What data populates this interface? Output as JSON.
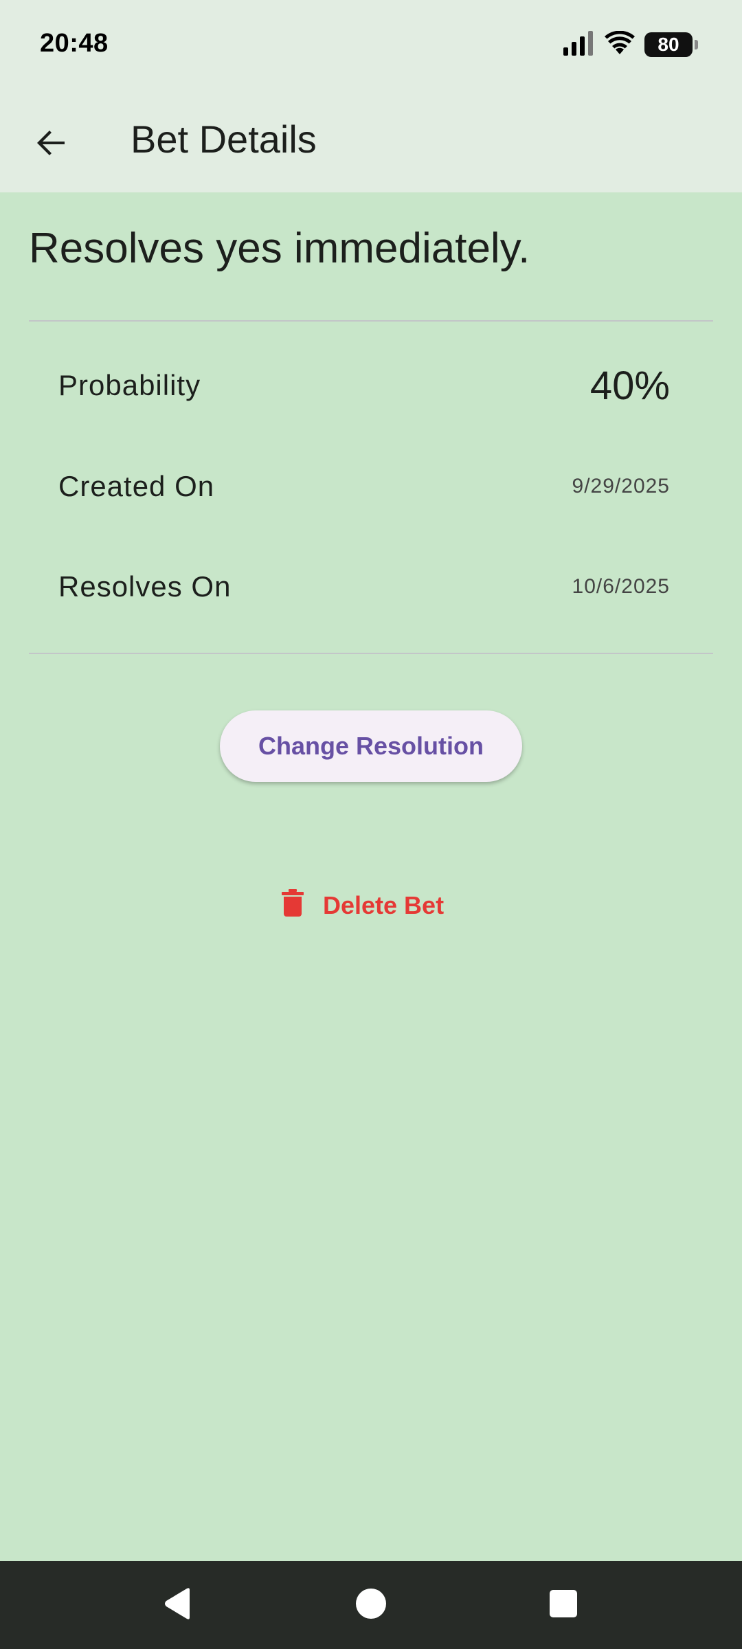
{
  "status_bar": {
    "time": "20:48",
    "battery": "80",
    "icons": [
      "signal-icon",
      "wifi-icon",
      "battery-icon"
    ]
  },
  "app_bar": {
    "title": "Bet Details",
    "back_icon": "arrow-back-icon"
  },
  "bet": {
    "title": "Resolves yes immediately.",
    "details": [
      {
        "label": "Probability",
        "value": "40%"
      },
      {
        "label": "Created On",
        "value": "9/29/2025"
      },
      {
        "label": "Resolves On",
        "value": "10/6/2025"
      }
    ]
  },
  "actions": {
    "change_resolution_label": "Change Resolution",
    "delete_label": "Delete Bet",
    "delete_icon": "trash-icon"
  },
  "nav_bar": {
    "buttons": [
      "back-triangle-icon",
      "home-circle-icon",
      "recents-square-icon"
    ]
  },
  "colors": {
    "background": "#c8e6c9",
    "app_bar": "#e2ede2",
    "accent": "#6750a4",
    "danger": "#e53935",
    "nav_bar": "#272b27"
  }
}
